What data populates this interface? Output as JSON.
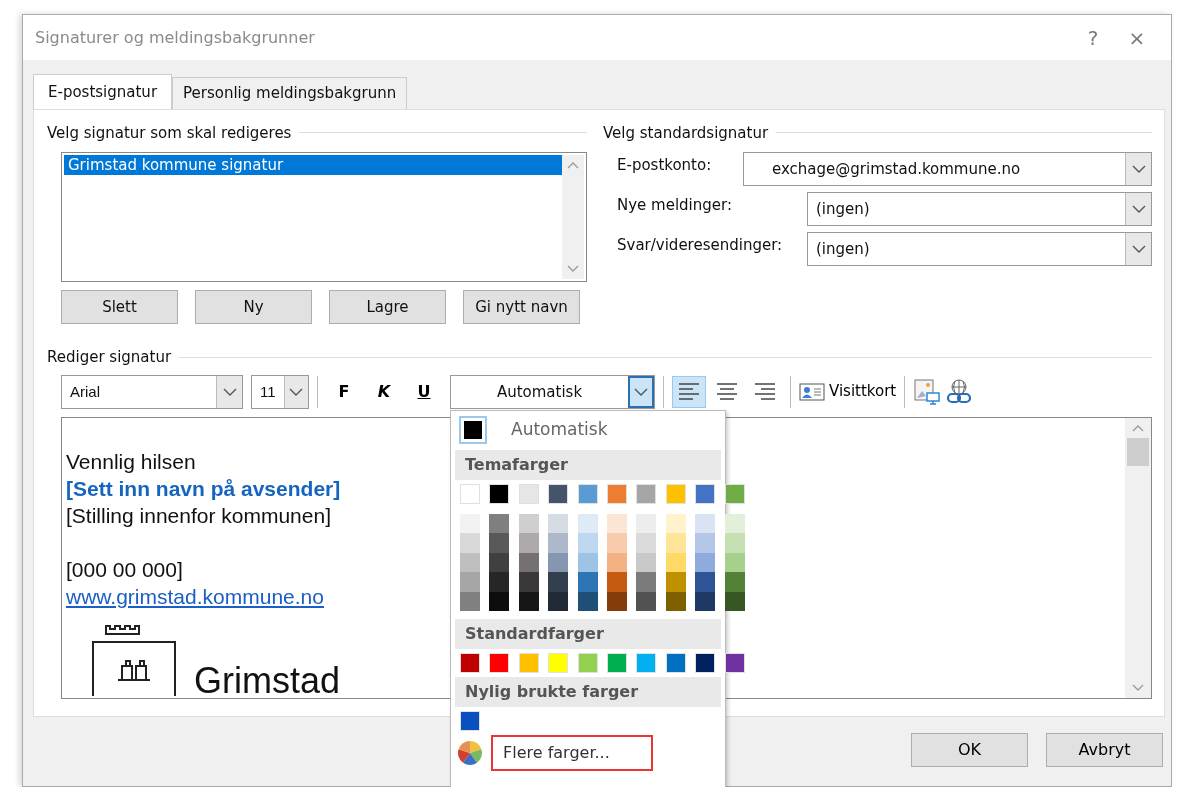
{
  "window": {
    "title": "Signaturer og meldingsbakgrunner",
    "help": "?",
    "close": "×"
  },
  "tabs": [
    {
      "label": "E-postsignatur",
      "selected": true
    },
    {
      "label": "Personlig meldingsbakgrunn",
      "selected": false
    }
  ],
  "select_signature": {
    "heading": "Velg signatur som skal redigeres",
    "items": [
      {
        "label": "Grimstad kommune signatur",
        "selected": true
      }
    ],
    "buttons": [
      "Slett",
      "Ny",
      "Lagre",
      "Gi nytt navn"
    ]
  },
  "default_signature": {
    "heading": "Velg standardsignatur",
    "fields": [
      {
        "label": "E-postkonto:",
        "value": "exchage@grimstad.kommune.no",
        "kind": "wide"
      },
      {
        "label": "Nye meldinger:",
        "value": "(ingen)",
        "kind": "narrow"
      },
      {
        "label": "Svar/videresendinger:",
        "value": "(ingen)",
        "kind": "narrow"
      }
    ]
  },
  "editor": {
    "heading": "Rediger signatur",
    "font": "Arial",
    "size": "11",
    "format_buttons": [
      {
        "label": "F",
        "kind": "bold"
      },
      {
        "label": "K",
        "kind": "italic"
      },
      {
        "label": "U",
        "kind": "underline"
      }
    ],
    "color": {
      "value": "Automatisk",
      "expanded": true
    },
    "align": [
      {
        "kind": "left",
        "selected": true
      },
      {
        "kind": "center",
        "selected": false
      },
      {
        "kind": "right",
        "selected": false
      }
    ],
    "business_card": "Visittkort",
    "lines": [
      {
        "kind": "text",
        "text": "Vennlig hilsen"
      },
      {
        "kind": "name",
        "text": "[Sett inn navn på avsender]"
      },
      {
        "kind": "text",
        "text": "[Stilling innenfor kommunen]"
      },
      {
        "kind": "blank"
      },
      {
        "kind": "text",
        "text": "[000 00 000]"
      },
      {
        "kind": "link",
        "text": "www.grimstad.kommune.no"
      }
    ],
    "logo_text": "Grimstad"
  },
  "color_menu": {
    "automatic": "Automatisk",
    "theme_heading": "Temafarger",
    "theme_colors": [
      {
        "color": "#ffffff",
        "shades": [
          {
            "color": "#f2f2f2"
          },
          {
            "color": "#d9d9d9"
          },
          {
            "color": "#bfbfbf"
          },
          {
            "color": "#a6a6a6"
          },
          {
            "color": "#808080"
          }
        ]
      },
      {
        "color": "#000000",
        "shades": [
          {
            "color": "#7f7f7f"
          },
          {
            "color": "#595959"
          },
          {
            "color": "#404040"
          },
          {
            "color": "#262626"
          },
          {
            "color": "#0d0d0d"
          }
        ]
      },
      {
        "color": "#e7e6e6",
        "shades": [
          {
            "color": "#d0cece"
          },
          {
            "color": "#aeaaaa"
          },
          {
            "color": "#757171"
          },
          {
            "color": "#3a3838"
          },
          {
            "color": "#171616"
          }
        ]
      },
      {
        "color": "#44546a",
        "shades": [
          {
            "color": "#d6dce4"
          },
          {
            "color": "#adb9ca"
          },
          {
            "color": "#8496b0"
          },
          {
            "color": "#333f4f"
          },
          {
            "color": "#222a35"
          }
        ]
      },
      {
        "color": "#5b9bd5",
        "shades": [
          {
            "color": "#deebf6"
          },
          {
            "color": "#bdd7ee"
          },
          {
            "color": "#9dc3e6"
          },
          {
            "color": "#2e75b5"
          },
          {
            "color": "#1f4e79"
          }
        ]
      },
      {
        "color": "#ed7d31",
        "shades": [
          {
            "color": "#fbe5d5"
          },
          {
            "color": "#f8cbad"
          },
          {
            "color": "#f4b183"
          },
          {
            "color": "#c55a11"
          },
          {
            "color": "#843c0b"
          }
        ]
      },
      {
        "color": "#a5a5a5",
        "shades": [
          {
            "color": "#ededed"
          },
          {
            "color": "#dbdbdb"
          },
          {
            "color": "#c9c9c9"
          },
          {
            "color": "#7b7b7b"
          },
          {
            "color": "#525252"
          }
        ]
      },
      {
        "color": "#ffc000",
        "shades": [
          {
            "color": "#fff2cc"
          },
          {
            "color": "#fee599"
          },
          {
            "color": "#ffd965"
          },
          {
            "color": "#bf9000"
          },
          {
            "color": "#7f6000"
          }
        ]
      },
      {
        "color": "#4472c4",
        "shades": [
          {
            "color": "#dae3f3"
          },
          {
            "color": "#b4c7e7"
          },
          {
            "color": "#8faadc"
          },
          {
            "color": "#2f5496"
          },
          {
            "color": "#1f3864"
          }
        ]
      },
      {
        "color": "#70ad47",
        "shades": [
          {
            "color": "#e2efd9"
          },
          {
            "color": "#c5e0b3"
          },
          {
            "color": "#a8d08d"
          },
          {
            "color": "#538135"
          },
          {
            "color": "#375623"
          }
        ]
      }
    ],
    "standard_heading": "Standardfarger",
    "standard_colors": [
      {
        "color": "#c00000"
      },
      {
        "color": "#ff0000"
      },
      {
        "color": "#ffc000"
      },
      {
        "color": "#ffff00"
      },
      {
        "color": "#92d050"
      },
      {
        "color": "#00b050"
      },
      {
        "color": "#00b0f0"
      },
      {
        "color": "#0070c0"
      },
      {
        "color": "#002060"
      },
      {
        "color": "#7030a0"
      }
    ],
    "recent_heading": "Nylig brukte farger",
    "recent_colors": [
      {
        "color": "#0a4fbf"
      }
    ],
    "more": {
      "label": "Flere farger...",
      "outlined": true
    }
  },
  "buttons": [
    {
      "label": "OK"
    },
    {
      "label": "Avbryt"
    }
  ]
}
